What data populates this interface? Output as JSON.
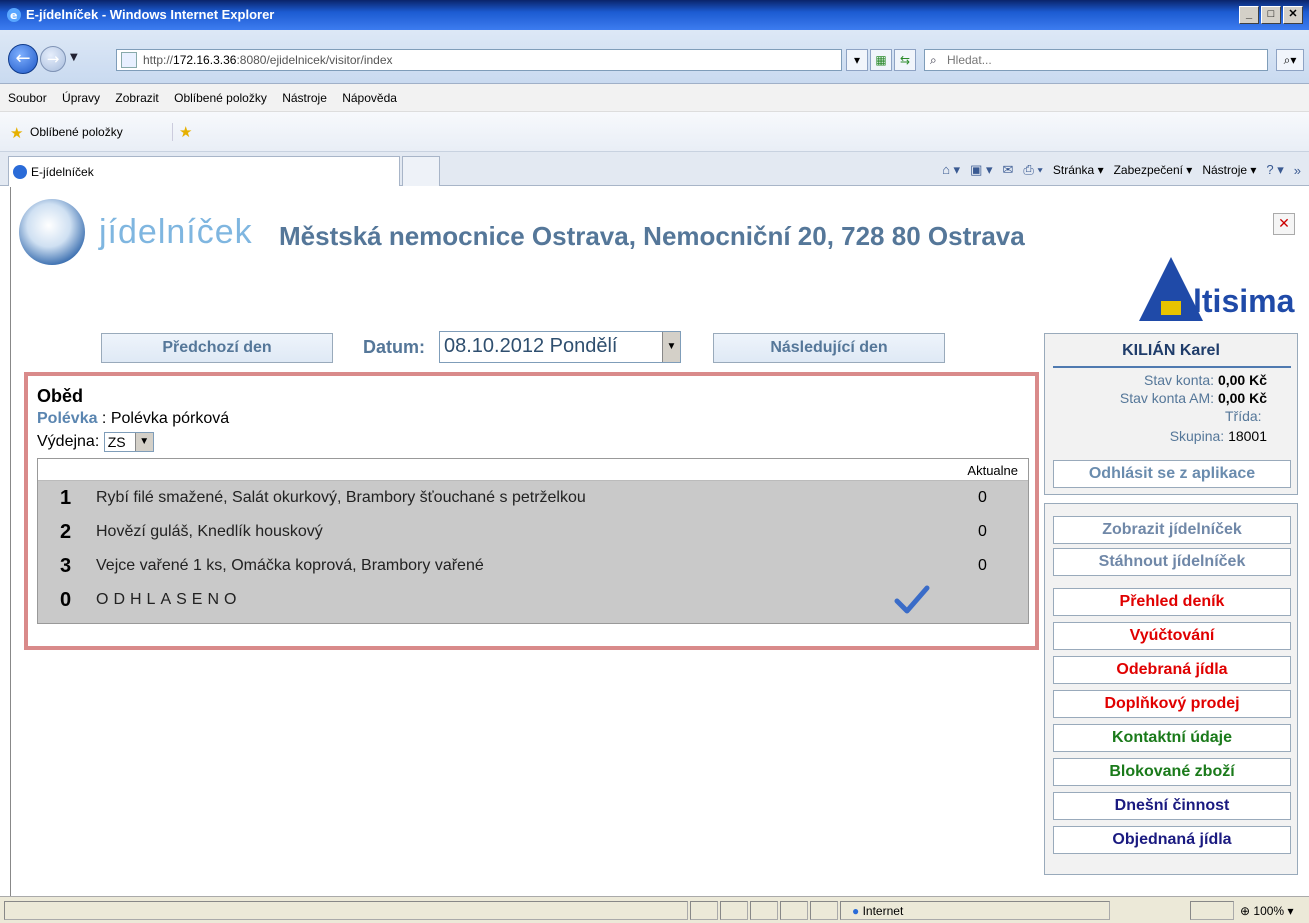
{
  "browser": {
    "title": "E-jídelníček - Windows Internet Explorer",
    "url_scheme": "http://",
    "url_host": "172.16.3.36",
    "url_rest": ":8080/ejidelnicek/visitor/index",
    "search_placeholder": "Hledat...",
    "menu": [
      "Soubor",
      "Úpravy",
      "Zobrazit",
      "Oblíbené položky",
      "Nástroje",
      "Nápověda"
    ],
    "favorites_label": "Oblíbené položky",
    "tab_title": "E-jídelníček",
    "cmd": {
      "stranka": "Stránka ▾",
      "zabezpeceni": "Zabezpečení ▾",
      "nastroje": "Nástroje ▾"
    },
    "status_zone": "Internet",
    "zoom": "100%"
  },
  "page": {
    "logo_text": "jídelníček",
    "hospital": "Městská nemocnice Ostrava, Nemocniční 20, 728 80 Ostrava",
    "brand_text": "ltisima",
    "prev_day": "Předchozí den",
    "next_day": "Následující den",
    "date_label": "Datum:",
    "date_value": "08.10.2012 Pondělí",
    "meal": {
      "title": "Oběd",
      "soup_label": "Polévka",
      "soup_value": " : Polévka pórková",
      "vydejna_label": "Výdejna:",
      "vydejna_value": "ZS",
      "column_header": "Aktualne",
      "items": [
        {
          "num": "1",
          "desc": "Rybí filé smažené, Salát okurkový, Brambory šťouchané s petrželkou",
          "count": "0"
        },
        {
          "num": "2",
          "desc": "Hovězí guláš, Knedlík houskový",
          "count": "0"
        },
        {
          "num": "3",
          "desc": "Vejce vařené 1 ks, Omáčka koprová, Brambory vařené",
          "count": "0"
        },
        {
          "num": "0",
          "desc": "ODHLASENO",
          "count": ""
        }
      ]
    }
  },
  "user": {
    "name": "KILIÁN Karel",
    "stav_konta_label": "Stav konta:",
    "stav_konta": "0,00 Kč",
    "stav_konta_am_label": "Stav konta AM:",
    "stav_konta_am": "0,00 Kč",
    "trida_label": "Třída:",
    "skupina_label": "Skupina:",
    "skupina": "18001",
    "logout": "Odhlásit se z aplikace"
  },
  "nav": {
    "zobrazit": "Zobrazit jídelníček",
    "stahnout": "Stáhnout jídelníček",
    "prehled": "Přehled deník",
    "vyuctovani": "Vyúčtování",
    "odebrana": "Odebraná jídla",
    "doplnkovy": "Doplňkový prodej",
    "kontakt": "Kontaktní údaje",
    "blokovane": "Blokované zboží",
    "dnesni": "Dnešní činnost",
    "objednana": "Objednaná jídla"
  },
  "colors": {
    "red": "#e00000",
    "green": "#1a7a1a",
    "navy": "#1a1a80",
    "grey_blue": "#7088a8",
    "border_red": "#d98a8a"
  }
}
